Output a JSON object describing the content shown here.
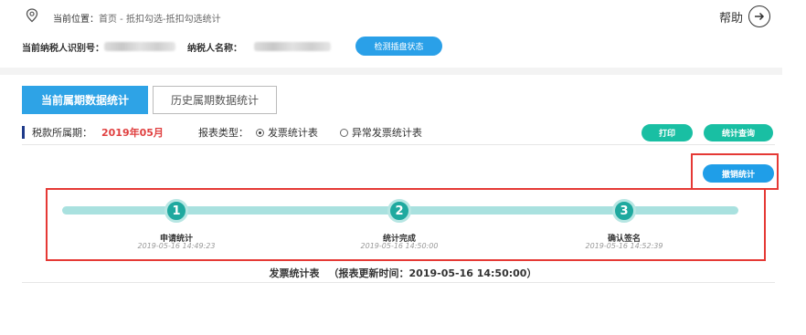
{
  "header": {
    "location_label": "当前位置：",
    "crumb_home": "首页",
    "crumb_sep": " - ",
    "crumb_path": "抵扣勾选-抵扣勾选统计",
    "help_label": "帮助"
  },
  "taxpayer": {
    "id_label": "当前纳税人识别号：",
    "name_label": "纳税人名称：",
    "check_button": "检测插盘状态"
  },
  "tabs": [
    {
      "label": "当前属期数据统计",
      "active": true
    },
    {
      "label": "历史属期数据统计",
      "active": false
    }
  ],
  "filter": {
    "period_label": "税款所属期：",
    "period_value": "2019年05月",
    "type_label": "报表类型：",
    "options": [
      {
        "label": "发票统计表",
        "selected": true
      },
      {
        "label": "异常发票统计表",
        "selected": false
      }
    ]
  },
  "actions": {
    "print": "打印",
    "query": "统计查询",
    "cancel": "撤销统计"
  },
  "steps": [
    {
      "number": "1",
      "label": "申请统计",
      "time": "2019-05-16 14:49:23"
    },
    {
      "number": "2",
      "label": "统计完成",
      "time": "2019-05-16 14:50:00"
    },
    {
      "number": "3",
      "label": "确认签名",
      "time": "2019-05-16 14:52:39"
    }
  ],
  "report": {
    "title": "发票统计表",
    "updated": "（报表更新时间：2019-05-16 14:50:00）"
  },
  "colors": {
    "accent_blue": "#2ea3e6",
    "teal": "#19bfa3",
    "highlight_red": "#e53935",
    "period_red": "#e04040"
  }
}
